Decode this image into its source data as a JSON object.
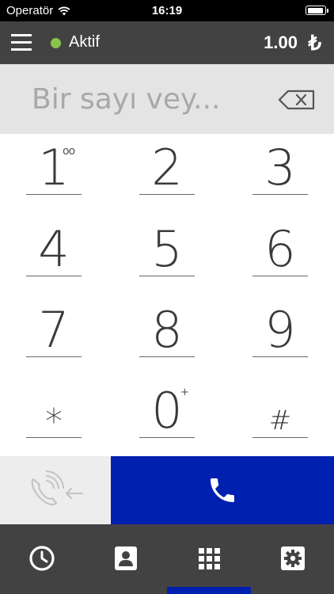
{
  "statusbar": {
    "carrier": "Operatör",
    "time": "16:19",
    "battery_level": 0.95
  },
  "topbar": {
    "status_text": "Aktif",
    "balance": "1.00",
    "currency_symbol": "₺"
  },
  "dialer": {
    "placeholder": "Bir sayı vey...",
    "keys": [
      {
        "label": "1",
        "sup": "oo"
      },
      {
        "label": "2"
      },
      {
        "label": "3"
      },
      {
        "label": "4"
      },
      {
        "label": "5"
      },
      {
        "label": "6"
      },
      {
        "label": "7"
      },
      {
        "label": "8"
      },
      {
        "label": "9"
      },
      {
        "label": "*"
      },
      {
        "label": "0",
        "sup": "+"
      },
      {
        "label": "#"
      }
    ]
  },
  "icons": {
    "backspace": "backspace-icon",
    "recall": "call-history-incoming-icon",
    "call": "phone-icon",
    "tabs": [
      "clock-icon",
      "contacts-icon",
      "keypad-icon",
      "settings-icon"
    ]
  },
  "colors": {
    "accent": "#0020b0",
    "status_active": "#8bc34a",
    "bar": "#424242"
  },
  "tabs": {
    "active_index": 2
  }
}
